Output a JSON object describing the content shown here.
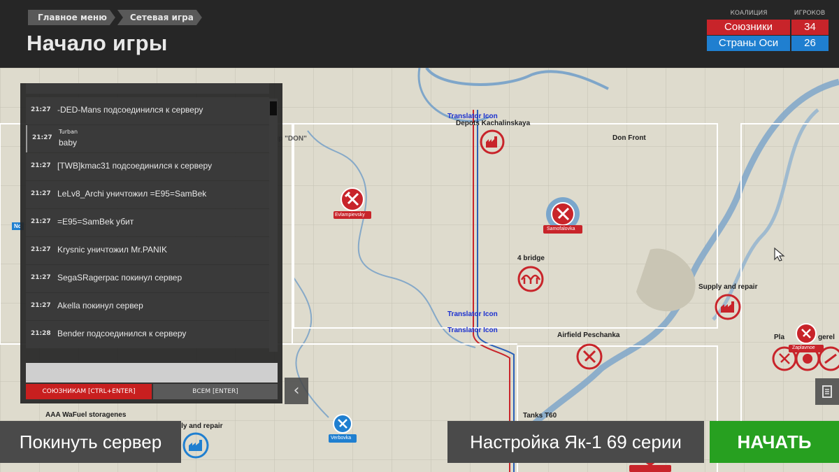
{
  "header": {
    "breadcrumb": [
      "Главное меню",
      "Сетевая игра"
    ],
    "title": "Начало игры"
  },
  "coalition_table": {
    "col_coalition": "КОАЛИЦИЯ",
    "col_players": "ИГРОКОВ",
    "rows": [
      {
        "name": "Союзники",
        "count": "34",
        "color": "#c8242a"
      },
      {
        "name": "Страны Оси",
        "count": "26",
        "color": "#1f7fd0"
      }
    ]
  },
  "map": {
    "labels": {
      "translator1": "Translator Icon",
      "depots": "Depots Kachalinskaya",
      "army": "Army Group \"DON\"",
      "don_front": "Don Front",
      "evlampievsky": "Evlampievsky",
      "samofalovka": "Samofalovka",
      "bridge": "4 bridge",
      "supply": "Supply and repair",
      "translator2": "Translator Icon",
      "translator3": "Translator Icon",
      "airfield": "Airfield Peschanka",
      "zaplavnoe": "Zaplavnoe",
      "aaa": "AAA WaFuel storagenes",
      "supply2": "ply and repair",
      "verbovka": "Verbovka",
      "tanks": "Tanks T60",
      "pla": "Pla",
      "fu": "Fu",
      "gerel": "gerel",
      "no": "No"
    },
    "ally_color": "#c8242a",
    "axis_color": "#1f7fd0"
  },
  "chat": {
    "messages": [
      {
        "time": "21:27",
        "text": "-DED-Mans подсоединился к серверу"
      },
      {
        "time": "21:27",
        "sender": "Turban",
        "text": "baby"
      },
      {
        "time": "21:27",
        "text": "[TWB]kmac31 подсоединился к серверу"
      },
      {
        "time": "21:27",
        "text": "LeLv8_Archi уничтожил =E95=SamBek"
      },
      {
        "time": "21:27",
        "text": "=E95=SamBek убит"
      },
      {
        "time": "21:27",
        "text": "Krysnic уничтожил Mr.PANIK"
      },
      {
        "time": "21:27",
        "text": "SegaSRagerpac покинул сервер"
      },
      {
        "time": "21:27",
        "text": "Akella покинул сервер"
      },
      {
        "time": "21:28",
        "text": "Bender подсоединился к серверу"
      }
    ],
    "input_value": "",
    "allies_button": "СОЮЗНИКАМ [CTRL+ENTER]",
    "all_button": "ВСЕМ [ENTER]"
  },
  "buttons": {
    "leave": "Покинуть сервер",
    "plane_setup": "Настройка Як-1 69 серии",
    "start": "НАЧАТЬ"
  },
  "icons": {
    "collapse": "chevron-left-icon",
    "menu": "list-icon"
  }
}
